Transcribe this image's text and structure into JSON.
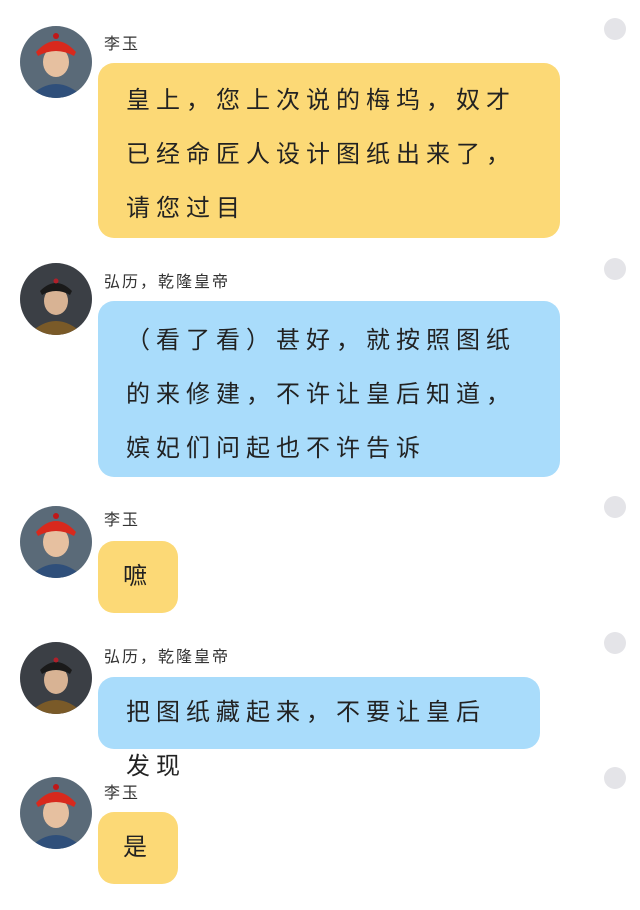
{
  "messages": [
    {
      "sender": "李玉",
      "avatar": "li-yu-avatar",
      "text": "皇上，您上次说的梅坞，奴才已经命匠人设计图纸出来了，请您过目",
      "color": "#fcd976"
    },
    {
      "sender": "弘历，乾隆皇帝",
      "avatar": "qianlong-avatar",
      "text": "（看了看）甚好，就按照图纸的来修建，不许让皇后知道，嫔妃们问起也不许告诉",
      "color": "#a9dcfb"
    },
    {
      "sender": "李玉",
      "avatar": "li-yu-avatar",
      "text": "嗻",
      "color": "#fcd976"
    },
    {
      "sender": "弘历，乾隆皇帝",
      "avatar": "qianlong-avatar",
      "text": "把图纸藏起来，不要让皇后发现",
      "color": "#a9dcfb"
    },
    {
      "sender": "李玉",
      "avatar": "li-yu-avatar",
      "text": "是",
      "color": "#fcd976"
    }
  ]
}
